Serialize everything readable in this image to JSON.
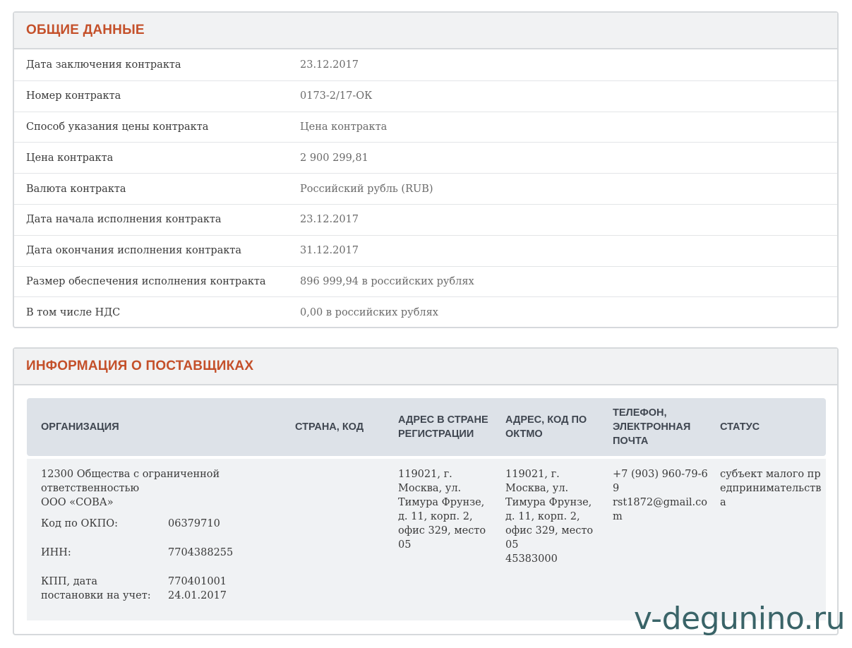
{
  "general": {
    "title": "ОБЩИЕ ДАННЫЕ",
    "rows": [
      {
        "label": "Дата заключения контракта",
        "value": "23.12.2017"
      },
      {
        "label": "Номер контракта",
        "value": "0173-2/17-ОК"
      },
      {
        "label": "Способ указания цены контракта",
        "value": "Цена контракта"
      },
      {
        "label": "Цена контракта",
        "value": "2 900 299,81"
      },
      {
        "label": "Валюта контракта",
        "value": "Российский рубль (RUB)"
      },
      {
        "label": "Дата начала исполнения контракта",
        "value": "23.12.2017"
      },
      {
        "label": "Дата окончания исполнения контракта",
        "value": "31.12.2017"
      },
      {
        "label": "Размер обеспечения исполнения контракта",
        "value": "896 999,94 в российских рублях"
      },
      {
        "label": "В том числе НДС",
        "value": "0,00 в российских рублях"
      }
    ]
  },
  "suppliers": {
    "title": "ИНФОРМАЦИЯ О ПОСТАВЩИКАХ",
    "headers": {
      "org": "ОРГАНИЗАЦИЯ",
      "country": "СТРАНА, КОД",
      "address_reg": "АДРЕС В СТРАНЕ РЕГИСТРАЦИИ",
      "address_oktmo": "АДРЕС, КОД ПО ОКТМО",
      "contact": "ТЕЛЕФОН, ЭЛЕКТРОННАЯ ПОЧТА",
      "status": "СТАТУС"
    },
    "row": {
      "org_name_line1": "12300 Общества с ограниченной",
      "org_name_line2": "ответственностью",
      "org_name_line3": "ООО «СОВА»",
      "okpo_label": "Код по ОКПО:",
      "okpo_value": "06379710",
      "inn_label": "ИНН:",
      "inn_value": "7704388255",
      "kpp_label": "КПП, дата постановки на учет:",
      "kpp_value": "770401001",
      "kpp_date": "24.01.2017",
      "country": "",
      "address_reg": "119021, г. Москва, ул. Тимура Фрунзе, д. 11, корп. 2, офис 329, место 05",
      "address_oktmo": "119021, г. Москва, ул. Тимура Фрунзе, д. 11, корп. 2, офис 329, место 05",
      "oktmo_code": "45383000",
      "phone": "+7 (903) 960-79-69",
      "email": "rst1872@gmail.com",
      "status": "субъект малого предпринимательства"
    }
  },
  "watermark": "v-degunino.ru"
}
